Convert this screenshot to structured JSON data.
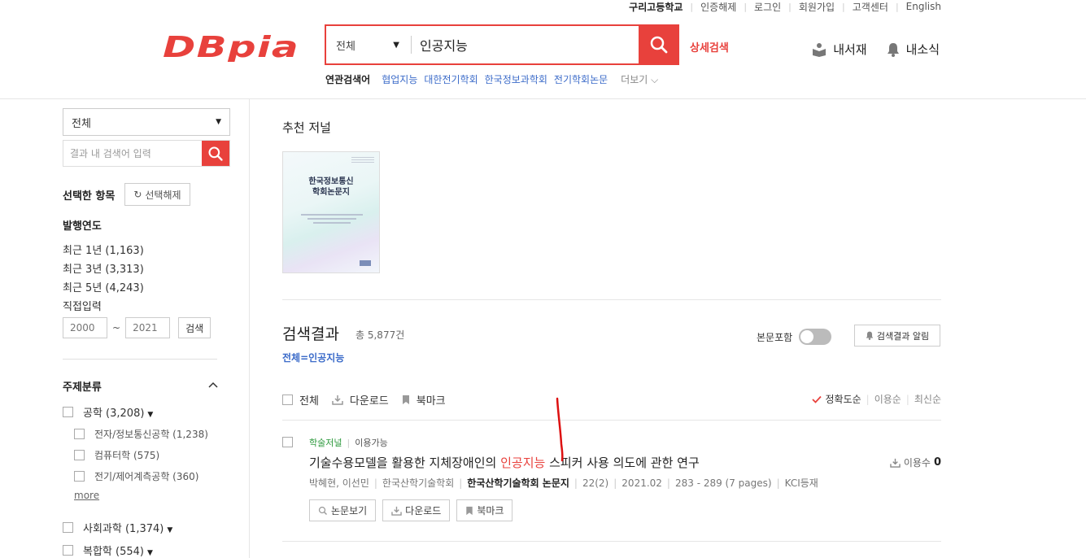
{
  "topbar": {
    "school": "구리고등학교",
    "links": [
      "인증해제",
      "로그인",
      "회원가입",
      "고객센터",
      "English"
    ]
  },
  "logo": {
    "text": "DBpia"
  },
  "search": {
    "scope": "전체",
    "query": "인공지능",
    "detail_label": "상세검색"
  },
  "header_right": {
    "library": "내서재",
    "news": "내소식"
  },
  "related": {
    "label": "연관검색어",
    "keywords": [
      "협업지능",
      "대한전기학회",
      "한국정보과학회",
      "전기학회논문"
    ],
    "more": "더보기"
  },
  "sidebar": {
    "scope": "전체",
    "search_placeholder": "결과 내 검색어 입력",
    "selected_label": "선택한 항목",
    "reset_label": "선택해제",
    "year_title": "발행연도",
    "year_options": [
      "최근 1년 (1,163)",
      "최근 3년 (3,313)",
      "최근 5년 (4,243)",
      "직접입력"
    ],
    "year_from": "2000",
    "year_sep": "~",
    "year_to": "2021",
    "year_btn": "검색",
    "subject_title": "주제분류",
    "subjects": [
      {
        "label": "공학 (3,208)"
      },
      {
        "label": "전자/정보통신공학 (1,238)"
      },
      {
        "label": "컴퓨터학 (575)"
      },
      {
        "label": "전기/제어계측공학 (360)"
      },
      {
        "label": "사회과학 (1,374)"
      },
      {
        "label": "복합학 (554)"
      }
    ],
    "more_label": "more"
  },
  "recommend": {
    "title": "추천 저널",
    "cover_title_1": "한국정보통신",
    "cover_title_2": "학회논문지"
  },
  "results": {
    "title": "검색결과",
    "count": "총 5,877건",
    "query": "전체=인공지능",
    "fulltext_label": "본문포함",
    "alert_label": "검색결과 알림",
    "tools": {
      "all": "전체",
      "download": "다운로드",
      "bookmark": "북마크"
    },
    "sort": [
      "정확도순",
      "이용순",
      "최신순"
    ],
    "items": [
      {
        "type": "학술저널",
        "avail": "이용가능",
        "title_pre": "기술수용모델을 활용한 지체장애인의 ",
        "title_hl": "인공지능",
        "title_post": " 스피커 사용 의도에 관한 연구",
        "authors": "박혜현, 이선민",
        "publisher": "한국산학기술학회",
        "journal": "한국산학기술학회 논문지",
        "volume": "22(2)",
        "date": "2021.02",
        "pages": "283 - 289 (7 pages)",
        "index": "KCI등재",
        "usage_label": "이용수",
        "usage_count": "0",
        "btn_view": "논문보기",
        "btn_download": "다운로드",
        "btn_bookmark": "북마크"
      }
    ]
  },
  "colors": {
    "accent": "#e8413c",
    "link": "#3b6bc9",
    "journal_type": "#2e9a3e"
  }
}
